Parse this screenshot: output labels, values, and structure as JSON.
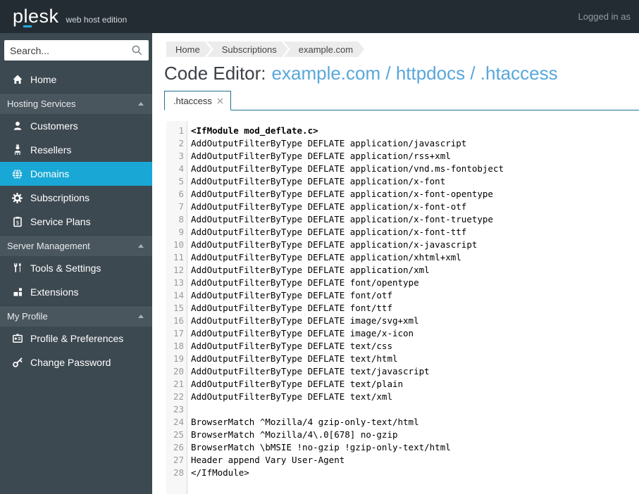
{
  "topbar": {
    "logo": "plesk",
    "tagline": "web host edition",
    "logged_in": "Logged in as"
  },
  "sidebar": {
    "search_placeholder": "Search...",
    "items": [
      {
        "type": "item",
        "id": "home",
        "label": "Home",
        "icon": "home-icon"
      },
      {
        "type": "section",
        "id": "hosting-services",
        "label": "Hosting Services"
      },
      {
        "type": "item",
        "id": "customers",
        "label": "Customers",
        "icon": "person-icon"
      },
      {
        "type": "item",
        "id": "resellers",
        "label": "Resellers",
        "icon": "person-badge-icon"
      },
      {
        "type": "item",
        "id": "domains",
        "label": "Domains",
        "icon": "globe-icon",
        "active": true
      },
      {
        "type": "item",
        "id": "subscriptions",
        "label": "Subscriptions",
        "icon": "gear-icon"
      },
      {
        "type": "item",
        "id": "service-plans",
        "label": "Service Plans",
        "icon": "clipboard-icon"
      },
      {
        "type": "section",
        "id": "server-management",
        "label": "Server Management"
      },
      {
        "type": "item",
        "id": "tools-settings",
        "label": "Tools & Settings",
        "icon": "tools-icon"
      },
      {
        "type": "item",
        "id": "extensions",
        "label": "Extensions",
        "icon": "blocks-icon"
      },
      {
        "type": "section",
        "id": "my-profile",
        "label": "My Profile"
      },
      {
        "type": "item",
        "id": "profile-preferences",
        "label": "Profile & Preferences",
        "icon": "id-card-icon"
      },
      {
        "type": "item",
        "id": "change-password",
        "label": "Change Password",
        "icon": "key-icon"
      }
    ]
  },
  "breadcrumb": [
    "Home",
    "Subscriptions",
    "example.com"
  ],
  "page": {
    "title_prefix": "Code Editor:",
    "title_path": "example.com / httpdocs / .htaccess"
  },
  "tabs": [
    {
      "label": ".htaccess"
    }
  ],
  "editor": {
    "lines": [
      "<IfModule mod_deflate.c>",
      "AddOutputFilterByType DEFLATE application/javascript",
      "AddOutputFilterByType DEFLATE application/rss+xml",
      "AddOutputFilterByType DEFLATE application/vnd.ms-fontobject",
      "AddOutputFilterByType DEFLATE application/x-font",
      "AddOutputFilterByType DEFLATE application/x-font-opentype",
      "AddOutputFilterByType DEFLATE application/x-font-otf",
      "AddOutputFilterByType DEFLATE application/x-font-truetype",
      "AddOutputFilterByType DEFLATE application/x-font-ttf",
      "AddOutputFilterByType DEFLATE application/x-javascript",
      "AddOutputFilterByType DEFLATE application/xhtml+xml",
      "AddOutputFilterByType DEFLATE application/xml",
      "AddOutputFilterByType DEFLATE font/opentype",
      "AddOutputFilterByType DEFLATE font/otf",
      "AddOutputFilterByType DEFLATE font/ttf",
      "AddOutputFilterByType DEFLATE image/svg+xml",
      "AddOutputFilterByType DEFLATE image/x-icon",
      "AddOutputFilterByType DEFLATE text/css",
      "AddOutputFilterByType DEFLATE text/html",
      "AddOutputFilterByType DEFLATE text/javascript",
      "AddOutputFilterByType DEFLATE text/plain",
      "AddOutputFilterByType DEFLATE text/xml",
      "",
      "BrowserMatch ^Mozilla/4 gzip-only-text/html",
      "BrowserMatch ^Mozilla/4\\.0[678] no-gzip",
      "BrowserMatch \\bMSIE !no-gzip !gzip-only-text/html",
      "Header append Vary User-Agent",
      "</IfModule>"
    ]
  },
  "colors": {
    "brand_accent": "#28aade",
    "active_item": "#19a8d5",
    "link": "#58a7db",
    "tab_border": "#20708f"
  }
}
